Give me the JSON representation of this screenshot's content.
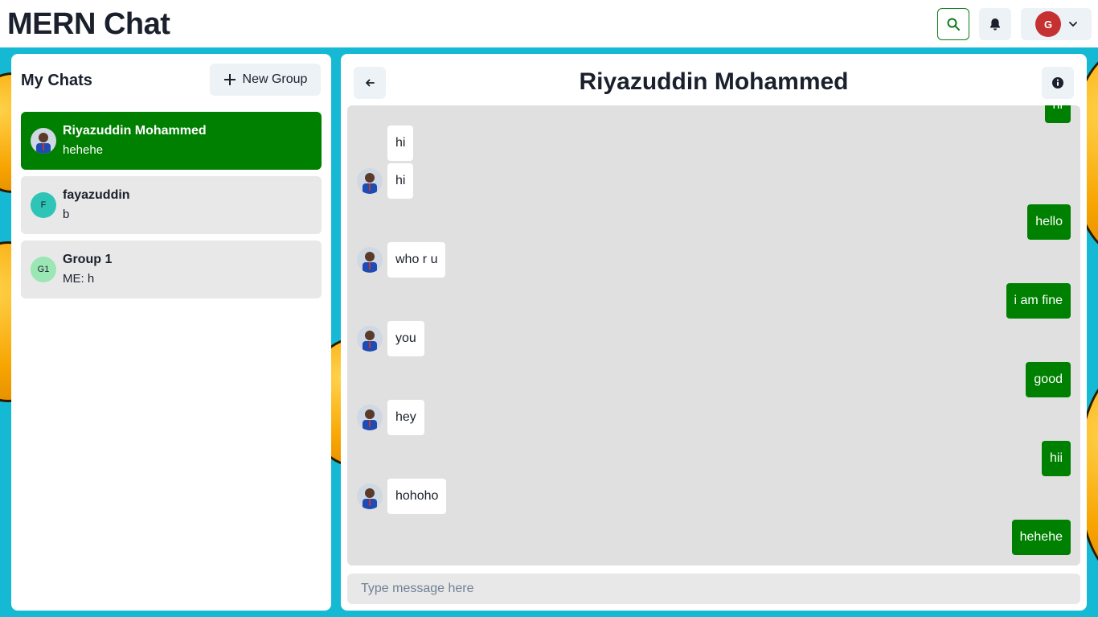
{
  "app": {
    "title": "MERN Chat"
  },
  "topbar": {
    "search_icon": "search-icon",
    "bell_icon": "bell-icon",
    "profile_initial": "G",
    "chevron_icon": "chevron-down-icon"
  },
  "sidebar": {
    "title": "My Chats",
    "new_group_label": "New Group",
    "chats": [
      {
        "name": "Riyazuddin Mohammed",
        "preview": "hehehe",
        "active": true,
        "avatar": "photo"
      },
      {
        "name": "fayazuddin",
        "preview": "b",
        "active": false,
        "avatar_initial": "F"
      },
      {
        "name": "Group 1",
        "preview": "ME: h",
        "active": false,
        "avatar_initial": "G1"
      }
    ]
  },
  "chat": {
    "title": "Riyazuddin Mohammed",
    "messages": [
      {
        "text": "hi",
        "direction": "out"
      },
      {
        "text": "hi",
        "direction": "in"
      },
      {
        "text": "hi",
        "direction": "in"
      },
      {
        "text": "hello",
        "direction": "out"
      },
      {
        "text": "who r u",
        "direction": "in"
      },
      {
        "text": "i am fine",
        "direction": "out"
      },
      {
        "text": "you",
        "direction": "in"
      },
      {
        "text": "good",
        "direction": "out"
      },
      {
        "text": "hey",
        "direction": "in"
      },
      {
        "text": "hii",
        "direction": "out"
      },
      {
        "text": "hohoho",
        "direction": "in"
      },
      {
        "text": "hehehe",
        "direction": "out"
      }
    ],
    "input_placeholder": "Type message here"
  },
  "colors": {
    "accent": "#008000",
    "avatar_g": "#c53030",
    "avatar_f": "#2ec4b6",
    "avatar_g1": "#9ae6b4"
  }
}
